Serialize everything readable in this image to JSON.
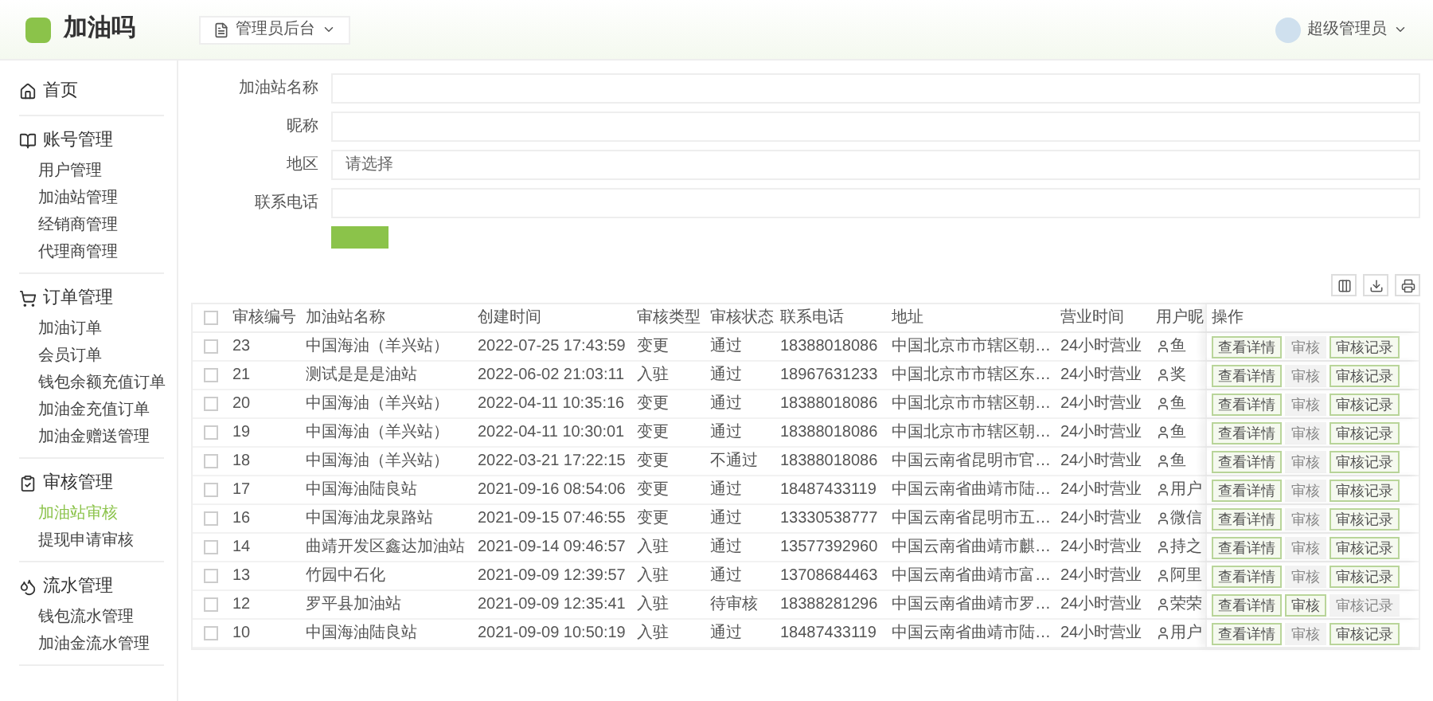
{
  "header": {
    "logo_text": "加油吗",
    "role_switch": "管理员后台",
    "role_switch_expanded": false,
    "user_name": "超级管理员"
  },
  "sidebar": {
    "sections": [
      {
        "title": "首页"
      },
      {
        "title": "账号管理",
        "items": [
          {
            "label": "用户管理",
            "selected": false
          },
          {
            "label": "加油站管理",
            "selected": false
          },
          {
            "label": "经销商管理",
            "selected": false
          },
          {
            "label": "代理商管理",
            "selected": false
          }
        ]
      },
      {
        "title": "订单管理",
        "items": [
          {
            "label": "加油订单",
            "selected": false
          },
          {
            "label": "会员订单",
            "selected": false
          },
          {
            "label": "钱包余额充值订单",
            "selected": false
          },
          {
            "label": "加油金充值订单",
            "selected": false
          },
          {
            "label": "加油金赠送管理",
            "selected": false
          }
        ]
      },
      {
        "title": "审核管理",
        "items": [
          {
            "label": "加油站审核",
            "selected": true
          },
          {
            "label": "提现申请审核",
            "selected": false
          }
        ]
      },
      {
        "title": "流水管理",
        "items": [
          {
            "label": "钱包流水管理",
            "selected": false
          },
          {
            "label": "加油金流水管理",
            "selected": false
          }
        ]
      }
    ]
  },
  "filters": [
    {
      "label": "加油站名称"
    },
    {
      "label": "昵称"
    },
    {
      "label": "地区",
      "placeholder": "请选择"
    },
    {
      "label": "联系电话"
    }
  ],
  "table": {
    "all_checked": false,
    "columns": [
      "审核编号",
      "加油站名称",
      "创建时间",
      "审核类型",
      "审核状态",
      "联系电话",
      "地址",
      "营业时间",
      "用户昵",
      "操作"
    ],
    "rows": [
      {
        "checked": false,
        "cells": [
          "23",
          "中国海油（羊兴站）",
          "2022-07-25 17:43:59",
          "变更",
          "通过",
          "18388018086",
          "中国北京市市辖区朝…",
          "24小时营业",
          "鱼"
        ],
        "actions": [
          {
            "label": "查看详情",
            "disabled": false
          },
          {
            "label": "审核",
            "disabled": true
          },
          {
            "label": "审核记录",
            "disabled": false
          }
        ]
      },
      {
        "checked": false,
        "cells": [
          "21",
          "测试是是是油站",
          "2022-06-02 21:03:11",
          "入驻",
          "通过",
          "18967631233",
          "中国北京市市辖区东…",
          "24小时营业",
          "奖"
        ],
        "actions": [
          {
            "label": "查看详情",
            "disabled": false
          },
          {
            "label": "审核",
            "disabled": true
          },
          {
            "label": "审核记录",
            "disabled": false
          }
        ]
      },
      {
        "checked": false,
        "cells": [
          "20",
          "中国海油（羊兴站）",
          "2022-04-11 10:35:16",
          "变更",
          "通过",
          "18388018086",
          "中国北京市市辖区朝…",
          "24小时营业",
          "鱼"
        ],
        "actions": [
          {
            "label": "查看详情",
            "disabled": false
          },
          {
            "label": "审核",
            "disabled": true
          },
          {
            "label": "审核记录",
            "disabled": false
          }
        ]
      },
      {
        "checked": false,
        "cells": [
          "19",
          "中国海油（羊兴站）",
          "2022-04-11 10:30:01",
          "变更",
          "通过",
          "18388018086",
          "中国北京市市辖区朝…",
          "24小时营业",
          "鱼"
        ],
        "actions": [
          {
            "label": "查看详情",
            "disabled": false
          },
          {
            "label": "审核",
            "disabled": true
          },
          {
            "label": "审核记录",
            "disabled": false
          }
        ]
      },
      {
        "checked": false,
        "cells": [
          "18",
          "中国海油（羊兴站）",
          "2022-03-21 17:22:15",
          "变更",
          "不通过",
          "18388018086",
          "中国云南省昆明市官…",
          "24小时营业",
          "鱼"
        ],
        "actions": [
          {
            "label": "查看详情",
            "disabled": false
          },
          {
            "label": "审核",
            "disabled": true
          },
          {
            "label": "审核记录",
            "disabled": false
          }
        ]
      },
      {
        "checked": false,
        "cells": [
          "17",
          "中国海油陆良站",
          "2021-09-16 08:54:06",
          "变更",
          "通过",
          "18487433119",
          "中国云南省曲靖市陆…",
          "24小时营业",
          "用户"
        ],
        "actions": [
          {
            "label": "查看详情",
            "disabled": false
          },
          {
            "label": "审核",
            "disabled": true
          },
          {
            "label": "审核记录",
            "disabled": false
          }
        ]
      },
      {
        "checked": false,
        "cells": [
          "16",
          "中国海油龙泉路站",
          "2021-09-15 07:46:55",
          "变更",
          "通过",
          "13330538777",
          "中国云南省昆明市五…",
          "24小时营业",
          "微信"
        ],
        "actions": [
          {
            "label": "查看详情",
            "disabled": false
          },
          {
            "label": "审核",
            "disabled": true
          },
          {
            "label": "审核记录",
            "disabled": false
          }
        ]
      },
      {
        "checked": false,
        "cells": [
          "14",
          "曲靖开发区鑫达加油站",
          "2021-09-14 09:46:57",
          "入驻",
          "通过",
          "13577392960",
          "中国云南省曲靖市麒…",
          "24小时营业",
          "持之"
        ],
        "actions": [
          {
            "label": "查看详情",
            "disabled": false
          },
          {
            "label": "审核",
            "disabled": true
          },
          {
            "label": "审核记录",
            "disabled": false
          }
        ]
      },
      {
        "checked": false,
        "cells": [
          "13",
          "竹园中石化",
          "2021-09-09 12:39:57",
          "入驻",
          "通过",
          "13708684463",
          "中国云南省曲靖市富…",
          "24小时营业",
          "阿里"
        ],
        "actions": [
          {
            "label": "查看详情",
            "disabled": false
          },
          {
            "label": "审核",
            "disabled": true
          },
          {
            "label": "审核记录",
            "disabled": false
          }
        ]
      },
      {
        "checked": false,
        "cells": [
          "12",
          "罗平县加油站",
          "2021-09-09 12:35:41",
          "入驻",
          "待审核",
          "18388281296",
          "中国云南省曲靖市罗…",
          "24小时营业",
          "荣荣"
        ],
        "actions": [
          {
            "label": "查看详情",
            "disabled": false
          },
          {
            "label": "审核",
            "disabled": false
          },
          {
            "label": "审核记录",
            "disabled": true
          }
        ]
      },
      {
        "checked": false,
        "cells": [
          "10",
          "中国海油陆良站",
          "2021-09-09 10:50:19",
          "入驻",
          "通过",
          "18487433119",
          "中国云南省曲靖市陆…",
          "24小时营业",
          "用户"
        ],
        "actions": [
          {
            "label": "查看详情",
            "disabled": false
          },
          {
            "label": "审核",
            "disabled": true
          },
          {
            "label": "审核记录",
            "disabled": false
          }
        ]
      }
    ]
  }
}
